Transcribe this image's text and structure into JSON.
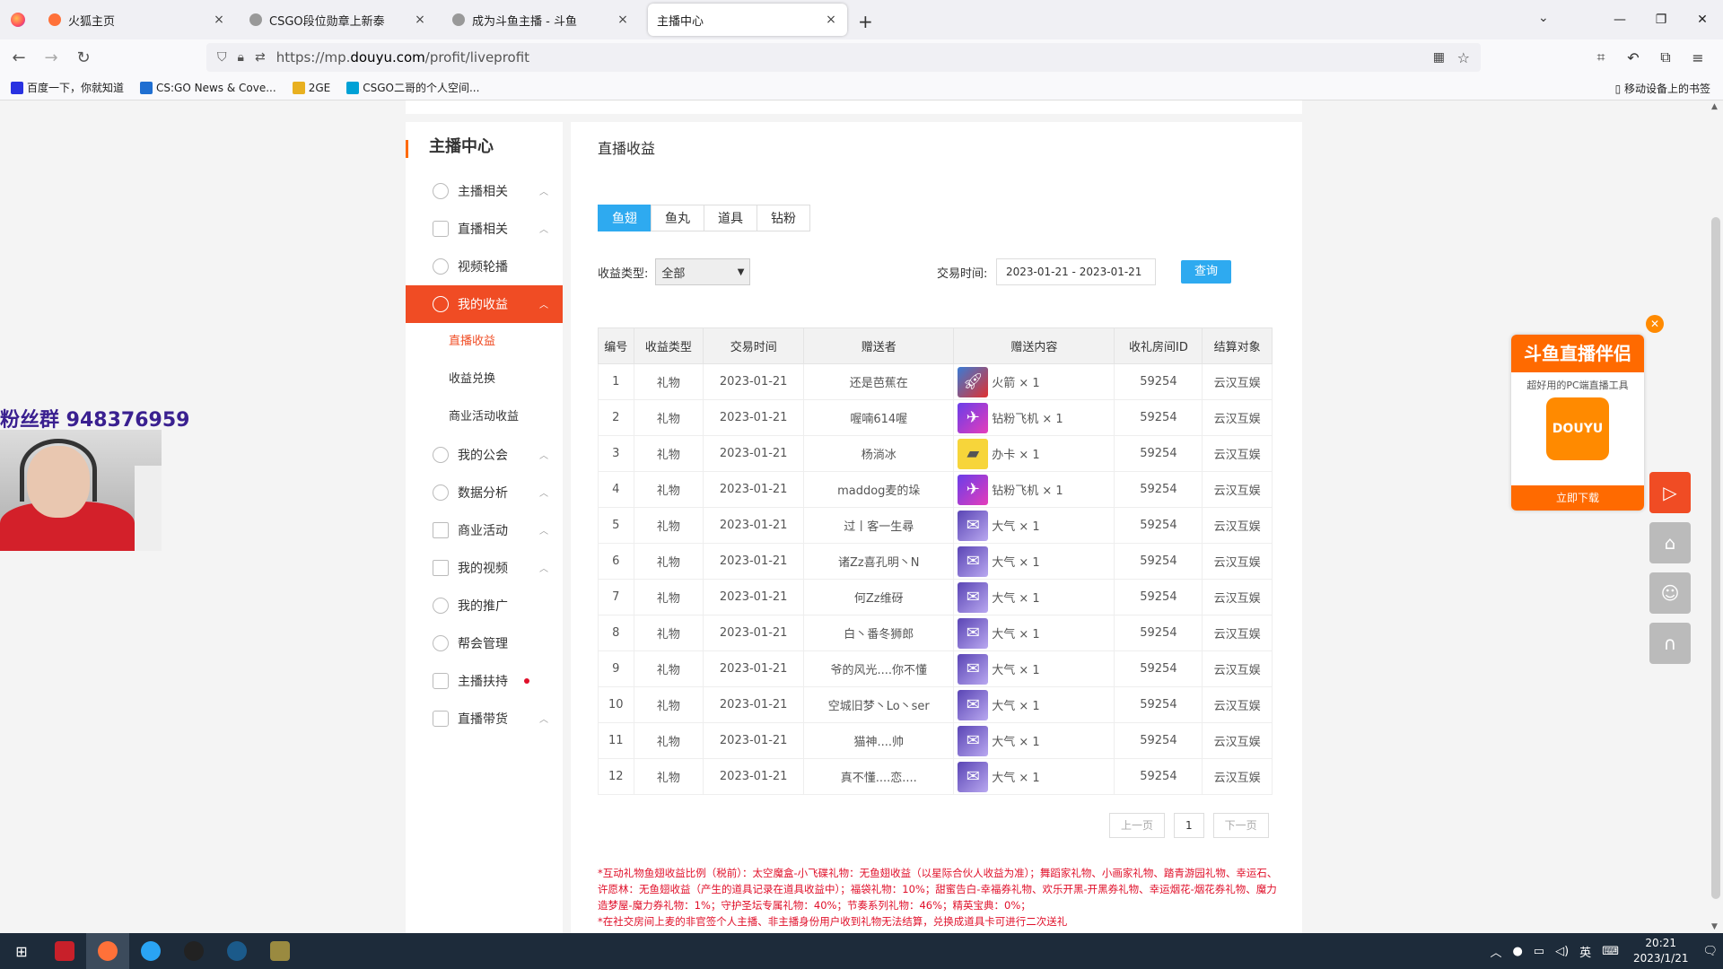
{
  "browser": {
    "tabs": [
      {
        "title": "火狐主页",
        "color": "#ff7139",
        "active": false
      },
      {
        "title": "CSGO段位勋章上新泰",
        "color": "#888888",
        "active": false
      },
      {
        "title": "成为斗鱼主播 - 斗鱼",
        "color": "#888888",
        "active": false
      },
      {
        "title": "主播中心",
        "color": "#888888",
        "active": true
      }
    ],
    "url_prefix": "https://mp.",
    "url_domain": "douyu.com",
    "url_path": "/profit/liveprofit",
    "bookmarks": [
      "百度一下，你就知道",
      "CS:GO News & Cove...",
      "2GE",
      "CSGO二哥的个人空间..."
    ],
    "mobile_bookmarks": "移动设备上的书签"
  },
  "sidebar": {
    "title": "主播中心",
    "items": [
      {
        "label": "主播相关",
        "icon": "mic-icon",
        "chevron": true
      },
      {
        "label": "直播相关",
        "icon": "video-icon",
        "chevron": true
      },
      {
        "label": "视频轮播",
        "icon": "carousel-icon",
        "chevron": false
      },
      {
        "label": "我的收益",
        "icon": "money-bag-icon",
        "chevron": true,
        "active": true
      },
      {
        "label": "我的公会",
        "icon": "shield-icon",
        "chevron": true
      },
      {
        "label": "数据分析",
        "icon": "pie-chart-icon",
        "chevron": true
      },
      {
        "label": "商业活动",
        "icon": "building-icon",
        "chevron": true
      },
      {
        "label": "我的视频",
        "icon": "film-icon",
        "chevron": true
      },
      {
        "label": "我的推广",
        "icon": "mic-icon",
        "chevron": false
      },
      {
        "label": "帮会管理",
        "icon": "gear-icon",
        "chevron": false
      },
      {
        "label": "主播扶持",
        "icon": "thumbs-up-icon",
        "chevron": false,
        "dot": true
      },
      {
        "label": "直播带货",
        "icon": "shopping-bag-icon",
        "chevron": true
      }
    ],
    "sub_items": [
      "直播收益",
      "收益兑换",
      "商业活动收益"
    ]
  },
  "main": {
    "title": "直播收益",
    "tabs": [
      "鱼翅",
      "鱼丸",
      "道具",
      "钻粉"
    ],
    "filter": {
      "type_label": "收益类型:",
      "type_value": "全部",
      "date_label": "交易时间:",
      "date_value": "2023-01-21 - 2023-01-21",
      "query": "查询"
    },
    "columns": [
      "编号",
      "收益类型",
      "交易时间",
      "赠送者",
      "赠送内容",
      "收礼房间ID",
      "结算对象"
    ],
    "rows": [
      [
        "1",
        "礼物",
        "2023-01-21",
        "还是芭蕉在",
        "火箭 × 1",
        "59254",
        "云汉互娱"
      ],
      [
        "2",
        "礼物",
        "2023-01-21",
        "喔喃614喔",
        "钻粉飞机 × 1",
        "59254",
        "云汉互娱"
      ],
      [
        "3",
        "礼物",
        "2023-01-21",
        "杨淌冰",
        "办卡 × 1",
        "59254",
        "云汉互娱"
      ],
      [
        "4",
        "礼物",
        "2023-01-21",
        "maddog麦的垛",
        "钻粉飞机 × 1",
        "59254",
        "云汉互娱"
      ],
      [
        "5",
        "礼物",
        "2023-01-21",
        "过丨客一生尋",
        "大气 × 1",
        "59254",
        "云汉互娱"
      ],
      [
        "6",
        "礼物",
        "2023-01-21",
        "诸Zz喜孔明丶N",
        "大气 × 1",
        "59254",
        "云汉互娱"
      ],
      [
        "7",
        "礼物",
        "2023-01-21",
        "何Zz维砑",
        "大气 × 1",
        "59254",
        "云汉互娱"
      ],
      [
        "8",
        "礼物",
        "2023-01-21",
        "白丶番冬狮郎",
        "大气 × 1",
        "59254",
        "云汉互娱"
      ],
      [
        "9",
        "礼物",
        "2023-01-21",
        "爷的风光....你不懂",
        "大气 × 1",
        "59254",
        "云汉互娱"
      ],
      [
        "10",
        "礼物",
        "2023-01-21",
        "空城旧梦丶Lo丶ser",
        "大气 × 1",
        "59254",
        "云汉互娱"
      ],
      [
        "11",
        "礼物",
        "2023-01-21",
        "猫神....帅",
        "大气 × 1",
        "59254",
        "云汉互娱"
      ],
      [
        "12",
        "礼物",
        "2023-01-21",
        "真不懂....恋....",
        "大气 × 1",
        "59254",
        "云汉互娱"
      ]
    ],
    "gift_icons": [
      "g-rocket",
      "g-plane",
      "g-card",
      "g-plane",
      "g-ok",
      "g-ok",
      "g-ok",
      "g-ok",
      "g-ok",
      "g-ok",
      "g-ok",
      "g-ok"
    ],
    "pager": {
      "prev": "上一页",
      "page": "1",
      "next": "下一页"
    },
    "notes": [
      "*互动礼物鱼翅收益比例（税前）：太空魔盒-小飞碟礼物：无鱼翅收益（以星际合伙人收益为准）；舞蹈家礼物、小画家礼物、踏青游园礼物、幸运石、许愿林：无鱼翅收益（产生的道具记录在道具收益中）；福袋礼物：10%；甜蜜告白-幸福券礼物、欢乐开黑-开黑券礼物、幸运烟花-烟花券礼物、魔力造梦屋-魔力券礼物：1%；守护圣坛专属礼物：40%；节奏系列礼物：46%；精英宝典：0%；",
      "*在社交房间上麦的非官签个人主播、非主播身份用户收到礼物无法结算，兑换成道具卡可进行二次送礼"
    ]
  },
  "overlay": {
    "fan_group": "粉丝群 948376959",
    "ad_title": "斗鱼直播伴侣",
    "ad_subtitle": "超好用的PC端直播工具",
    "ad_logo": "DOUYU",
    "ad_button": "立即下载"
  },
  "taskbar": {
    "time": "20:21",
    "date": "2023/1/21",
    "ime": "英"
  }
}
